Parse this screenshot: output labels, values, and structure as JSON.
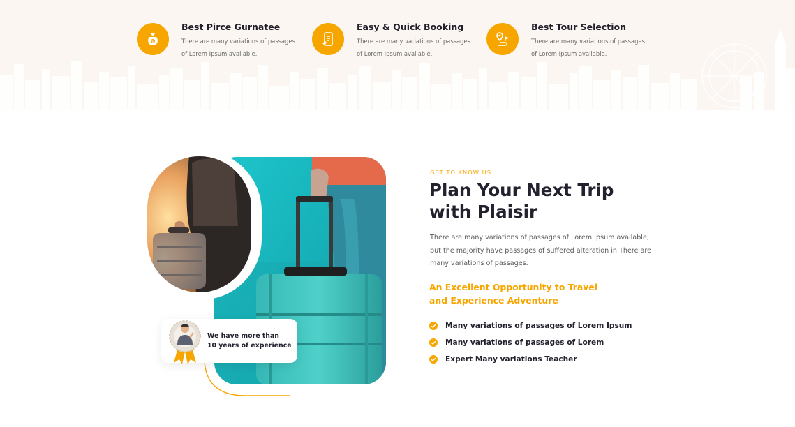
{
  "features": [
    {
      "icon": "money-bag-icon",
      "title": "Best Pirce Gurnatee",
      "desc": "There are many variations of passages of Lorem Ipsum available."
    },
    {
      "icon": "booking-phone-icon",
      "title": "Easy & Quick Booking",
      "desc": "There are many variations of passages of Lorem Ipsum available."
    },
    {
      "icon": "map-route-icon",
      "title": "Best Tour Selection",
      "desc": "There are many variations of passages of Lorem Ipsum available."
    }
  ],
  "about": {
    "tag": "GET TO KNOW US",
    "heading": "Plan Your Next Trip with Plaisir",
    "paragraph": "There are many variations of passages of Lorem Ipsum available, but the majority have passages of suffered alteration in There are many variations of passages.",
    "subheading": "An Excellent Opportunity to Travel and Experience Adventure",
    "list": [
      "Many variations of passages of Lorem Ipsum",
      "Many variations of passages of Lorem",
      "Expert Many variations Teacher"
    ],
    "badge": {
      "line1": "We have more than",
      "line2": "10 years of experience"
    }
  },
  "colors": {
    "accent": "#f7a600",
    "teal": "#2fc3c8",
    "cream": "#fbf6f1",
    "dark": "#24212f"
  }
}
